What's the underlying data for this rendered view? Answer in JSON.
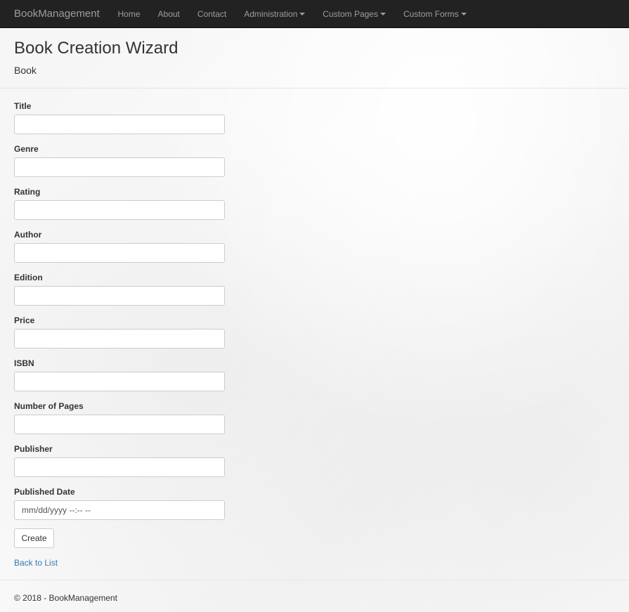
{
  "navbar": {
    "brand": "BookManagement",
    "links": [
      {
        "label": "Home",
        "dropdown": false
      },
      {
        "label": "About",
        "dropdown": false
      },
      {
        "label": "Contact",
        "dropdown": false
      },
      {
        "label": "Administration",
        "dropdown": true
      },
      {
        "label": "Custom Pages",
        "dropdown": true
      },
      {
        "label": "Custom Forms",
        "dropdown": true
      }
    ]
  },
  "page": {
    "title": "Book Creation Wizard",
    "subtitle": "Book"
  },
  "form": {
    "fields": [
      {
        "label": "Title",
        "value": "",
        "placeholder": ""
      },
      {
        "label": "Genre",
        "value": "",
        "placeholder": ""
      },
      {
        "label": "Rating",
        "value": "",
        "placeholder": ""
      },
      {
        "label": "Author",
        "value": "",
        "placeholder": ""
      },
      {
        "label": "Edition",
        "value": "",
        "placeholder": ""
      },
      {
        "label": "Price",
        "value": "",
        "placeholder": ""
      },
      {
        "label": "ISBN",
        "value": "",
        "placeholder": ""
      },
      {
        "label": "Number of Pages",
        "value": "",
        "placeholder": ""
      },
      {
        "label": "Publisher",
        "value": "",
        "placeholder": ""
      },
      {
        "label": "Published Date",
        "value": "",
        "placeholder": "mm/dd/yyyy --:-- --"
      }
    ],
    "create_label": "Create",
    "back_label": "Back to List"
  },
  "footer": {
    "text": "© 2018 - BookManagement"
  }
}
